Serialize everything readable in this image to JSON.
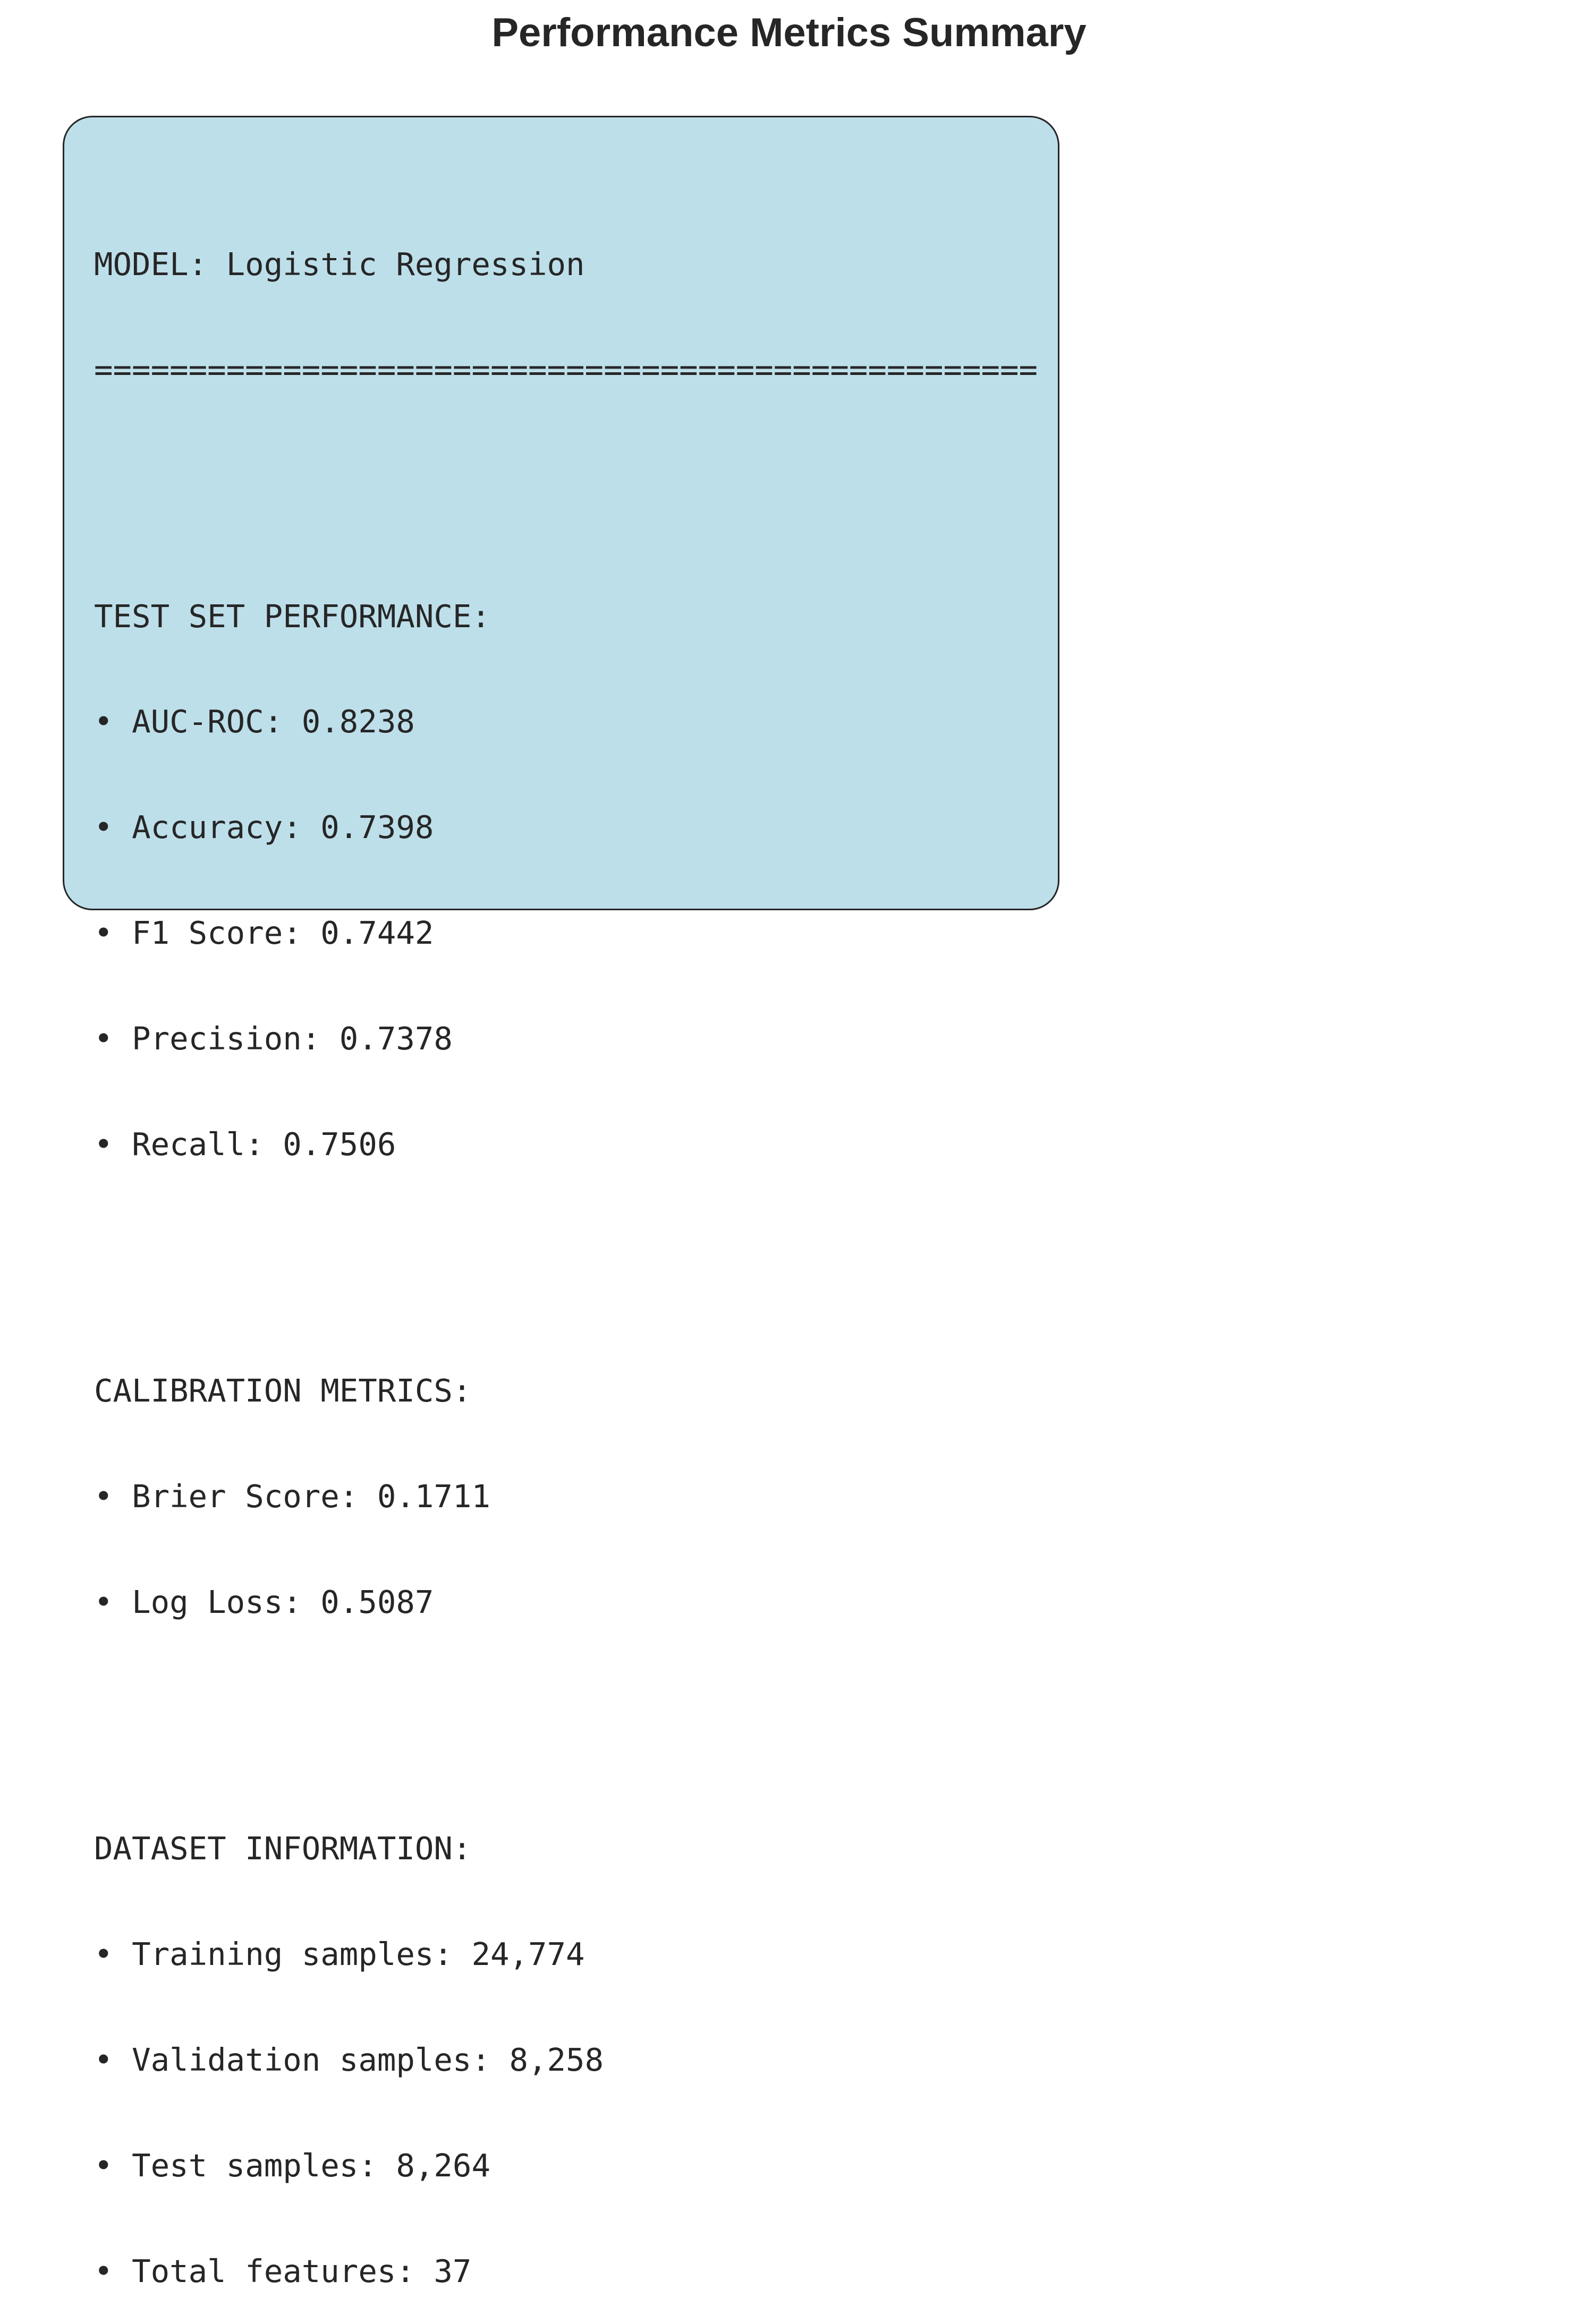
{
  "title": "Performance Metrics Summary",
  "colors": {
    "box_fill": "#bddfea",
    "box_border": "#262626",
    "text": "#262626",
    "background": "#ffffff"
  },
  "model_line": "MODEL: Logistic Regression",
  "separator": "==================================================",
  "bullet": "•",
  "sections": {
    "test_set": {
      "heading": "TEST SET PERFORMANCE:",
      "items": [
        "AUC-ROC: 0.8238",
        "Accuracy: 0.7398",
        "F1 Score: 0.7442",
        "Precision: 0.7378",
        "Recall: 0.7506"
      ]
    },
    "calibration": {
      "heading": "CALIBRATION METRICS:",
      "items": [
        "Brier Score: 0.1711",
        "Log Loss: 0.5087"
      ]
    },
    "dataset": {
      "heading": "DATASET INFORMATION:",
      "items": [
        "Training samples: 24,774",
        "Validation samples: 8,258",
        "Test samples: 8,264",
        "Total features: 37"
      ]
    }
  }
}
